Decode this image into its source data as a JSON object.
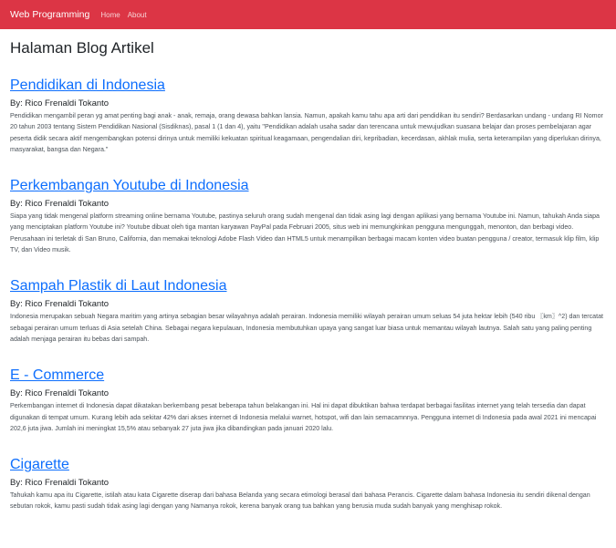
{
  "navbar": {
    "brand": "Web Programming",
    "links": [
      {
        "label": "Home"
      },
      {
        "label": "About"
      }
    ]
  },
  "page": {
    "title": "Halaman Blog Artikel"
  },
  "articles": [
    {
      "title": "Pendidikan di Indonesia",
      "author": "By: Rico Frenaldi Tokanto",
      "body": "Pendidikan mengambil peran yg amat penting bagi anak - anak, remaja, orang dewasa bahkan lansia. Namun, apakah kamu tahu apa arti dari pendidikan itu sendiri? Berdasarkan undang - undang RI Nomor 20 tahun 2003 tentang Sistem Pendidikan Nasional (Sisdiknas), pasal 1 (1 dan 4), yaitu \"Pendidikan adalah usaha sadar dan terencana untuk mewujudkan suasana belajar dan proses pembelajaran agar peserta didik secara aktif mengembangkan potensi dirinya untuk memiliki kekuatan spiritual keagamaan, pengendalian diri, kepribadian, kecerdasan, akhlak mulia, serta keterampilan yang diperlukan dirinya, masyarakat, bangsa dan Negara.\""
    },
    {
      "title": "Perkembangan Youtube di Indonesia",
      "author": "By: Rico Frenaldi Tokanto",
      "body": "Siapa yang tidak mengenal platform streaming online bernama Youtube, pastinya seluruh orang sudah mengenal dan tidak asing lagi dengan aplikasi yang bernama Youtube ini. Namun, tahukah Anda siapa yang menciptakan platform Youtube ini? Youtube dibuat oleh tiga mantan karyawan PayPal pada Februari 2005, situs web ini memungkinkan pengguna mengunggah, menonton, dan berbagi video. Perusahaan ini terletak di San Bruno, California, dan memakai teknologi Adobe Flash Video dan HTML5 untuk menampilkan berbagai macam konten video buatan pengguna / creator, termasuk klip film, klip TV, dan Video musik."
    },
    {
      "title": "Sampah Plastik di Laut Indonesia",
      "author": "By: Rico Frenaldi Tokanto",
      "body": "Indonesia merupakan sebuah Negara maritim yang artinya sebagian besar wilayahnya adalah perairan. Indonesia memiliki wilayah perairan umum seluas 54 juta hektar lebih (540 ribu 〖km〗^2) dan tercatat sebagai perairan umum terluas di Asia setelah China. Sebagai negara kepulauan, Indonesia membutuhkan upaya yang sangat luar biasa untuk memantau wilayah lautnya. Salah satu yang paling penting adalah menjaga perairan itu bebas dari sampah."
    },
    {
      "title": "E - Commerce",
      "author": "By: Rico Frenaldi Tokanto",
      "body": "Perkembangan internet di Indonesia dapat dikatakan berkembang pesat beberapa tahun belakangan ini. Hal ini dapat dibuktikan bahwa terdapat berbagai fasilitas internet yang telah tersedia dan dapat digunakan di tempat umum. Kurang lebih ada sekitar 42% dari akses internet di Indonesia melalui warnet, hotspot, wifi dan lain semacamnnya. Pengguna internet di Indonesia pada awal 2021 ini mencapai 202,6 juta jiwa. Jumlah ini meningkat 15,5% atau sebanyak 27 juta jiwa jika dibandingkan pada januari 2020 lalu."
    },
    {
      "title": "Cigarette",
      "author": "By: Rico Frenaldi Tokanto",
      "body": "Tahukah kamu apa itu Cigarette, istilah atau kata Cigarette diserap dari bahasa Belanda yang secara etimologi berasal dari bahasa Perancis. Cigarette dalam bahasa Indonesia itu sendiri dikenal dengan sebutan rokok, kamu pasti sudah tidak asing lagi dengan yang Namanya rokok, kerena banyak orang tua bahkan yang berusia muda sudah banyak yang menghisap rokok."
    }
  ]
}
